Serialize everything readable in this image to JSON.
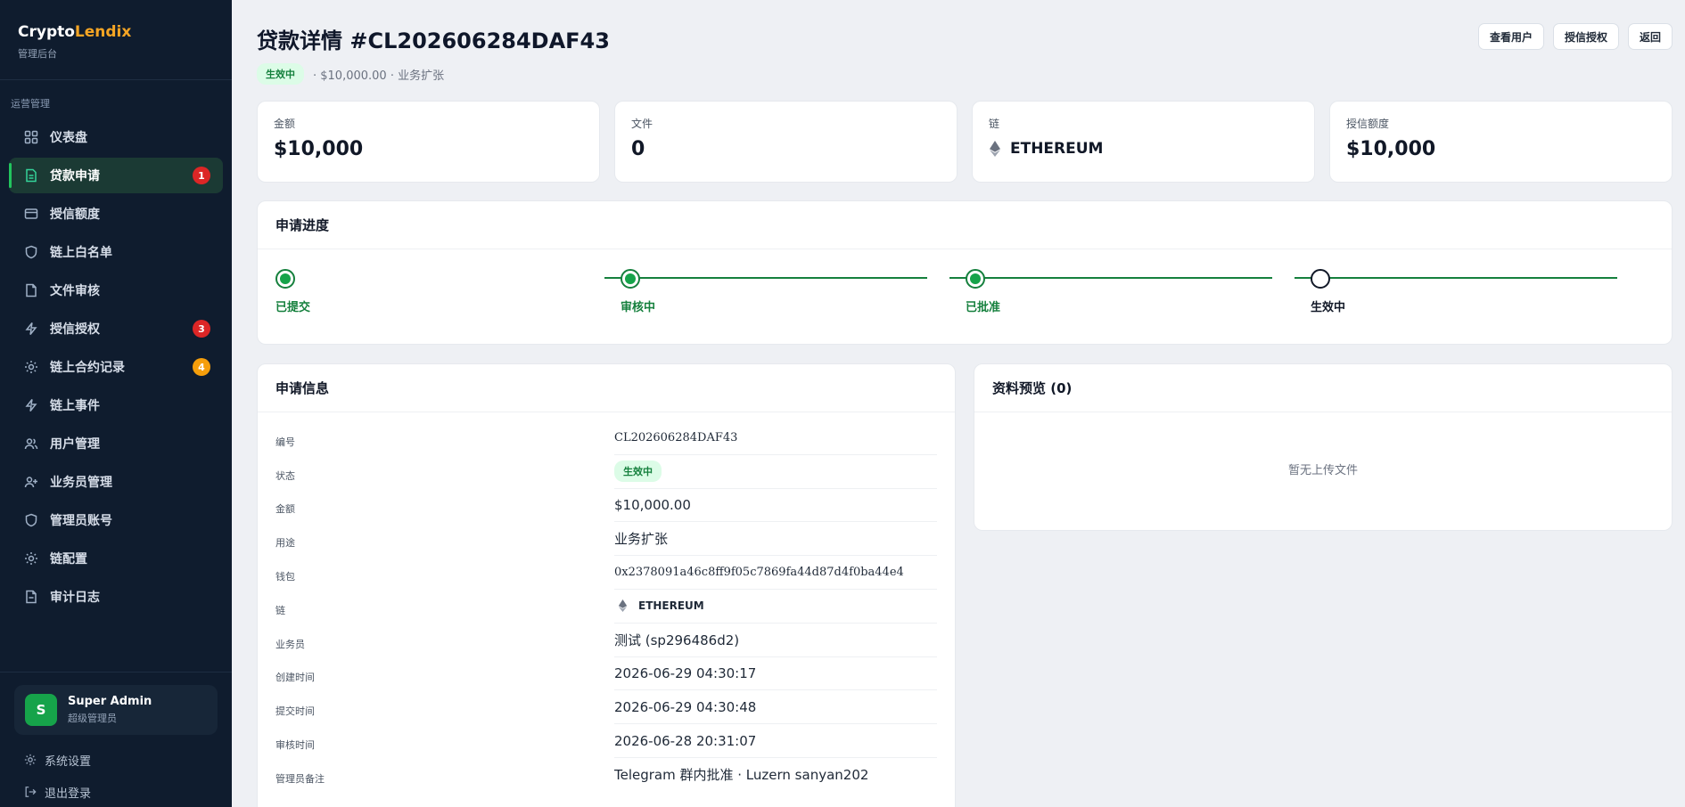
{
  "brand": {
    "name_part1": "Crypto",
    "name_part2": "Lendix",
    "subtitle": "管理后台"
  },
  "sidebar": {
    "section_label": "运营管理",
    "items": [
      {
        "label": "仪表盘",
        "icon": "grid-icon",
        "badge": null
      },
      {
        "label": "贷款申请",
        "icon": "document-icon",
        "badge": "1",
        "active": true
      },
      {
        "label": "授信额度",
        "icon": "card-icon",
        "badge": null
      },
      {
        "label": "链上白名单",
        "icon": "shield-icon",
        "badge": null
      },
      {
        "label": "文件审核",
        "icon": "file-icon",
        "badge": null
      },
      {
        "label": "授信授权",
        "icon": "bolt-icon",
        "badge": "3"
      },
      {
        "label": "链上合约记录",
        "icon": "sun-icon",
        "badge": "4"
      },
      {
        "label": "链上事件",
        "icon": "bolt-icon",
        "badge": null
      },
      {
        "label": "用户管理",
        "icon": "users-icon",
        "badge": null
      },
      {
        "label": "业务员管理",
        "icon": "user-plus-icon",
        "badge": null
      },
      {
        "label": "管理员账号",
        "icon": "shield-icon",
        "badge": null
      },
      {
        "label": "链配置",
        "icon": "sun-icon",
        "badge": null
      },
      {
        "label": "审计日志",
        "icon": "file-icon",
        "badge": null
      }
    ],
    "user": {
      "initial": "S",
      "name": "Super Admin",
      "role": "超级管理员"
    },
    "footer": {
      "settings": "系统设置",
      "logout": "退出登录"
    }
  },
  "header": {
    "title": "贷款详情 #CL202606284DAF43",
    "status": "生效中",
    "meta": "· $10,000.00 · 业务扩张",
    "actions": {
      "view_user": "查看用户",
      "credit_auth": "授信授权",
      "back": "返回"
    }
  },
  "stats": [
    {
      "label": "金额",
      "value": "$10,000"
    },
    {
      "label": "文件",
      "value": "0"
    },
    {
      "label": "链",
      "value": "ETHEREUM"
    },
    {
      "label": "授信额度",
      "value": "$10,000"
    }
  ],
  "progress": {
    "title": "申请进度",
    "steps": [
      {
        "label": "已提交",
        "done": true
      },
      {
        "label": "审核中",
        "done": true
      },
      {
        "label": "已批准",
        "done": true
      },
      {
        "label": "生效中",
        "done": false
      }
    ]
  },
  "info": {
    "title": "申请信息",
    "rows": [
      {
        "key": "编号",
        "value": "CL202606284DAF43"
      },
      {
        "key": "状态",
        "value": "生效中"
      },
      {
        "key": "金额",
        "value": "$10,000.00"
      },
      {
        "key": "用途",
        "value": "业务扩张"
      },
      {
        "key": "钱包",
        "value": "0x2378091a46c8ff9f05c7869fa44d87d4f0ba44e4"
      },
      {
        "key": "链",
        "value": "ETHEREUM"
      },
      {
        "key": "业务员",
        "value": "测试 (sp296486d2)"
      },
      {
        "key": "创建时间",
        "value": "2026-06-29 04:30:17"
      },
      {
        "key": "提交时间",
        "value": "2026-06-29 04:30:48"
      },
      {
        "key": "审核时间",
        "value": "2026-06-28 20:31:07"
      },
      {
        "key": "管理员备注",
        "value": "Telegram 群内批准 · Luzern sanyan202"
      }
    ]
  },
  "preview": {
    "title": "资料预览 (0)",
    "empty": "暂无上传文件"
  }
}
